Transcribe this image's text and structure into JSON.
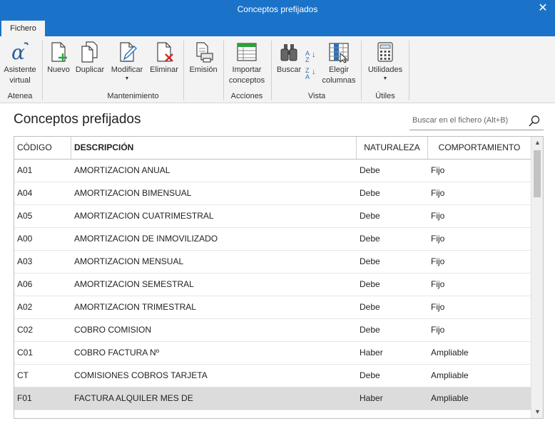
{
  "window": {
    "title": "Conceptos prefijados",
    "close_glyph": "✕"
  },
  "tabs": [
    {
      "label": "Fichero"
    }
  ],
  "ribbon": {
    "buttons": {
      "asistente": {
        "line1": "Asistente",
        "line2": "virtual",
        "icon": "alpha-icon"
      },
      "nuevo": {
        "label": "Nuevo",
        "icon": "new-document-icon"
      },
      "duplicar": {
        "label": "Duplicar",
        "icon": "duplicate-icon"
      },
      "modificar": {
        "label": "Modificar",
        "icon": "edit-document-icon"
      },
      "eliminar": {
        "label": "Eliminar",
        "icon": "delete-document-icon"
      },
      "emision": {
        "label": "Emisión",
        "icon": "print-icon"
      },
      "importar": {
        "line1": "Importar",
        "line2": "conceptos",
        "icon": "import-icon"
      },
      "buscar": {
        "label": "Buscar",
        "icon": "binoculars-icon"
      },
      "elegir": {
        "line1": "Elegir",
        "line2": "columnas",
        "icon": "columns-icon"
      },
      "utilidades": {
        "label": "Utilidades",
        "icon": "calculator-icon"
      }
    },
    "groups": {
      "atenea": "Atenea",
      "mantenimiento": "Mantenimiento",
      "acciones": "Acciones",
      "vista": "Vista",
      "utiles": "Útiles"
    },
    "sort_az": {
      "a": "A",
      "z": "Z"
    }
  },
  "page": {
    "title": "Conceptos prefijados"
  },
  "search": {
    "placeholder": "Buscar en el fichero (Alt+B)"
  },
  "table": {
    "headers": {
      "codigo": "CÓDIGO",
      "descripcion": "DESCRIPCIÓN",
      "naturaleza": "NATURALEZA",
      "comportamiento": "COMPORTAMIENTO"
    },
    "rows": [
      {
        "codigo": "A01",
        "descripcion": "AMORTIZACION ANUAL",
        "naturaleza": "Debe",
        "comportamiento": "Fijo"
      },
      {
        "codigo": "A04",
        "descripcion": "AMORTIZACION BIMENSUAL",
        "naturaleza": "Debe",
        "comportamiento": "Fijo"
      },
      {
        "codigo": "A05",
        "descripcion": "AMORTIZACION CUATRIMESTRAL",
        "naturaleza": "Debe",
        "comportamiento": "Fijo"
      },
      {
        "codigo": "A00",
        "descripcion": "AMORTIZACION DE INMOVILIZADO",
        "naturaleza": "Debe",
        "comportamiento": "Fijo"
      },
      {
        "codigo": "A03",
        "descripcion": "AMORTIZACION MENSUAL",
        "naturaleza": "Debe",
        "comportamiento": "Fijo"
      },
      {
        "codigo": "A06",
        "descripcion": "AMORTIZACION SEMESTRAL",
        "naturaleza": "Debe",
        "comportamiento": "Fijo"
      },
      {
        "codigo": "A02",
        "descripcion": "AMORTIZACION TRIMESTRAL",
        "naturaleza": "Debe",
        "comportamiento": "Fijo"
      },
      {
        "codigo": "C02",
        "descripcion": "COBRO COMISION",
        "naturaleza": "Debe",
        "comportamiento": "Fijo"
      },
      {
        "codigo": "C01",
        "descripcion": "COBRO FACTURA Nº",
        "naturaleza": "Haber",
        "comportamiento": "Ampliable"
      },
      {
        "codigo": "CT",
        "descripcion": "COMISIONES COBROS TARJETA",
        "naturaleza": "Debe",
        "comportamiento": "Ampliable"
      },
      {
        "codigo": "F01",
        "descripcion": "FACTURA ALQUILER MES DE",
        "naturaleza": "Haber",
        "comportamiento": "Ampliable",
        "selected": true
      }
    ]
  },
  "colors": {
    "accent": "#1a73c8",
    "ribbon_bg": "#f3f3f3",
    "selected_row": "#dcdcdc"
  }
}
